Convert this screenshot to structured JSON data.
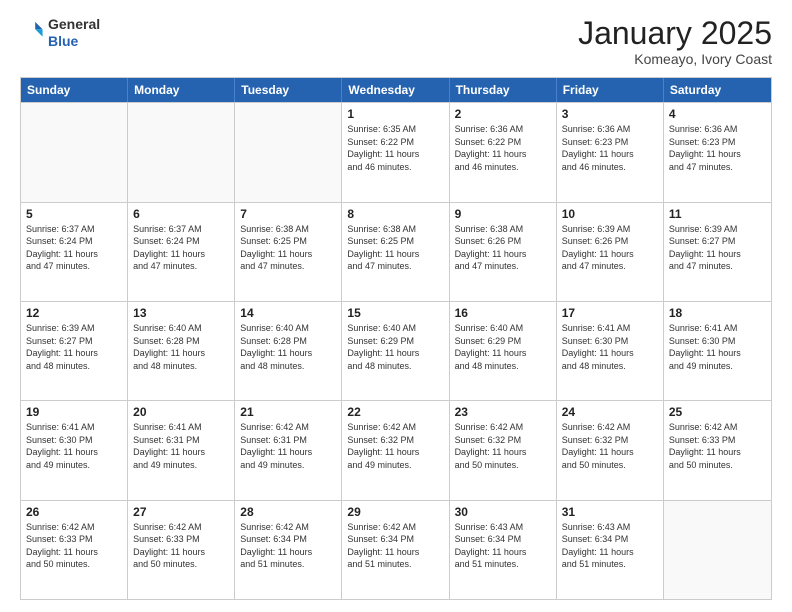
{
  "header": {
    "logo_line1": "General",
    "logo_line2": "Blue",
    "title": "January 2025",
    "subtitle": "Komeayo, Ivory Coast"
  },
  "weekdays": [
    "Sunday",
    "Monday",
    "Tuesday",
    "Wednesday",
    "Thursday",
    "Friday",
    "Saturday"
  ],
  "weeks": [
    [
      {
        "day": "",
        "info": "",
        "empty": true
      },
      {
        "day": "",
        "info": "",
        "empty": true
      },
      {
        "day": "",
        "info": "",
        "empty": true
      },
      {
        "day": "1",
        "info": "Sunrise: 6:35 AM\nSunset: 6:22 PM\nDaylight: 11 hours\nand 46 minutes.",
        "empty": false
      },
      {
        "day": "2",
        "info": "Sunrise: 6:36 AM\nSunset: 6:22 PM\nDaylight: 11 hours\nand 46 minutes.",
        "empty": false
      },
      {
        "day": "3",
        "info": "Sunrise: 6:36 AM\nSunset: 6:23 PM\nDaylight: 11 hours\nand 46 minutes.",
        "empty": false
      },
      {
        "day": "4",
        "info": "Sunrise: 6:36 AM\nSunset: 6:23 PM\nDaylight: 11 hours\nand 47 minutes.",
        "empty": false
      }
    ],
    [
      {
        "day": "5",
        "info": "Sunrise: 6:37 AM\nSunset: 6:24 PM\nDaylight: 11 hours\nand 47 minutes.",
        "empty": false
      },
      {
        "day": "6",
        "info": "Sunrise: 6:37 AM\nSunset: 6:24 PM\nDaylight: 11 hours\nand 47 minutes.",
        "empty": false
      },
      {
        "day": "7",
        "info": "Sunrise: 6:38 AM\nSunset: 6:25 PM\nDaylight: 11 hours\nand 47 minutes.",
        "empty": false
      },
      {
        "day": "8",
        "info": "Sunrise: 6:38 AM\nSunset: 6:25 PM\nDaylight: 11 hours\nand 47 minutes.",
        "empty": false
      },
      {
        "day": "9",
        "info": "Sunrise: 6:38 AM\nSunset: 6:26 PM\nDaylight: 11 hours\nand 47 minutes.",
        "empty": false
      },
      {
        "day": "10",
        "info": "Sunrise: 6:39 AM\nSunset: 6:26 PM\nDaylight: 11 hours\nand 47 minutes.",
        "empty": false
      },
      {
        "day": "11",
        "info": "Sunrise: 6:39 AM\nSunset: 6:27 PM\nDaylight: 11 hours\nand 47 minutes.",
        "empty": false
      }
    ],
    [
      {
        "day": "12",
        "info": "Sunrise: 6:39 AM\nSunset: 6:27 PM\nDaylight: 11 hours\nand 48 minutes.",
        "empty": false
      },
      {
        "day": "13",
        "info": "Sunrise: 6:40 AM\nSunset: 6:28 PM\nDaylight: 11 hours\nand 48 minutes.",
        "empty": false
      },
      {
        "day": "14",
        "info": "Sunrise: 6:40 AM\nSunset: 6:28 PM\nDaylight: 11 hours\nand 48 minutes.",
        "empty": false
      },
      {
        "day": "15",
        "info": "Sunrise: 6:40 AM\nSunset: 6:29 PM\nDaylight: 11 hours\nand 48 minutes.",
        "empty": false
      },
      {
        "day": "16",
        "info": "Sunrise: 6:40 AM\nSunset: 6:29 PM\nDaylight: 11 hours\nand 48 minutes.",
        "empty": false
      },
      {
        "day": "17",
        "info": "Sunrise: 6:41 AM\nSunset: 6:30 PM\nDaylight: 11 hours\nand 48 minutes.",
        "empty": false
      },
      {
        "day": "18",
        "info": "Sunrise: 6:41 AM\nSunset: 6:30 PM\nDaylight: 11 hours\nand 49 minutes.",
        "empty": false
      }
    ],
    [
      {
        "day": "19",
        "info": "Sunrise: 6:41 AM\nSunset: 6:30 PM\nDaylight: 11 hours\nand 49 minutes.",
        "empty": false
      },
      {
        "day": "20",
        "info": "Sunrise: 6:41 AM\nSunset: 6:31 PM\nDaylight: 11 hours\nand 49 minutes.",
        "empty": false
      },
      {
        "day": "21",
        "info": "Sunrise: 6:42 AM\nSunset: 6:31 PM\nDaylight: 11 hours\nand 49 minutes.",
        "empty": false
      },
      {
        "day": "22",
        "info": "Sunrise: 6:42 AM\nSunset: 6:32 PM\nDaylight: 11 hours\nand 49 minutes.",
        "empty": false
      },
      {
        "day": "23",
        "info": "Sunrise: 6:42 AM\nSunset: 6:32 PM\nDaylight: 11 hours\nand 50 minutes.",
        "empty": false
      },
      {
        "day": "24",
        "info": "Sunrise: 6:42 AM\nSunset: 6:32 PM\nDaylight: 11 hours\nand 50 minutes.",
        "empty": false
      },
      {
        "day": "25",
        "info": "Sunrise: 6:42 AM\nSunset: 6:33 PM\nDaylight: 11 hours\nand 50 minutes.",
        "empty": false
      }
    ],
    [
      {
        "day": "26",
        "info": "Sunrise: 6:42 AM\nSunset: 6:33 PM\nDaylight: 11 hours\nand 50 minutes.",
        "empty": false
      },
      {
        "day": "27",
        "info": "Sunrise: 6:42 AM\nSunset: 6:33 PM\nDaylight: 11 hours\nand 50 minutes.",
        "empty": false
      },
      {
        "day": "28",
        "info": "Sunrise: 6:42 AM\nSunset: 6:34 PM\nDaylight: 11 hours\nand 51 minutes.",
        "empty": false
      },
      {
        "day": "29",
        "info": "Sunrise: 6:42 AM\nSunset: 6:34 PM\nDaylight: 11 hours\nand 51 minutes.",
        "empty": false
      },
      {
        "day": "30",
        "info": "Sunrise: 6:43 AM\nSunset: 6:34 PM\nDaylight: 11 hours\nand 51 minutes.",
        "empty": false
      },
      {
        "day": "31",
        "info": "Sunrise: 6:43 AM\nSunset: 6:34 PM\nDaylight: 11 hours\nand 51 minutes.",
        "empty": false
      },
      {
        "day": "",
        "info": "",
        "empty": true
      }
    ]
  ]
}
